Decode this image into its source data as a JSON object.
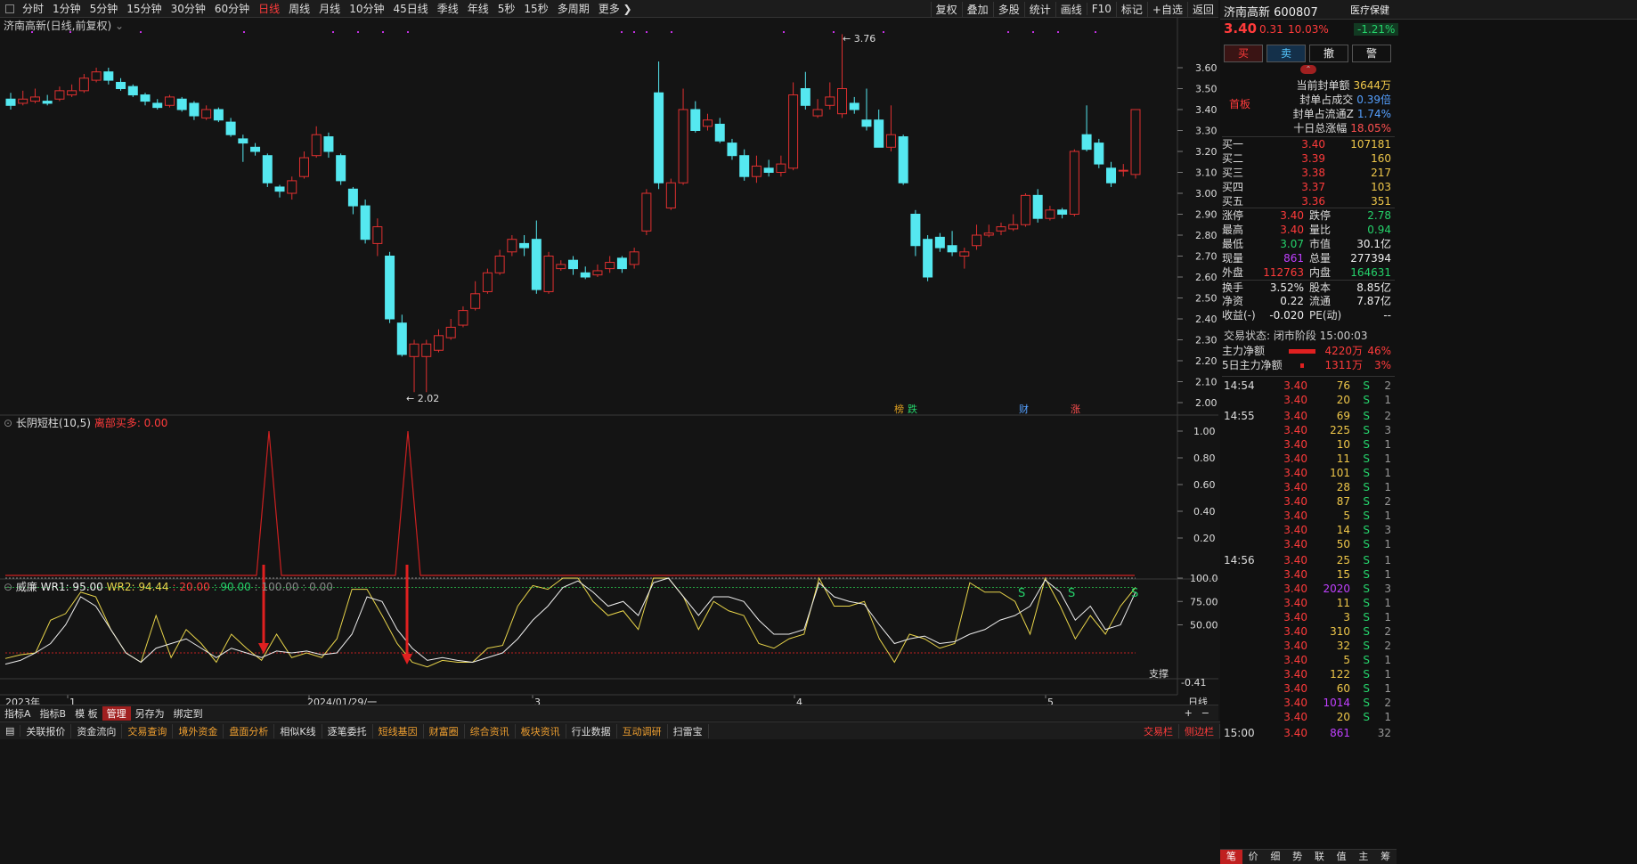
{
  "toolbar": {
    "left": [
      "分时",
      "1分钟",
      "5分钟",
      "15分钟",
      "30分钟",
      "60分钟",
      "日线",
      "周线",
      "月线",
      "10分钟",
      "45日线",
      "季线",
      "年线",
      "5秒",
      "15秒",
      "多周期",
      "更多 ❯"
    ],
    "active": "日线",
    "right": [
      "复权",
      "叠加",
      "多股",
      "统计",
      "画线",
      "F10",
      "标记",
      "+自选",
      "返回"
    ]
  },
  "chart_title": "济南高新(日线,前复权)",
  "price_axis": [
    "3.60",
    "3.50",
    "3.40",
    "3.30",
    "3.20",
    "3.10",
    "3.00",
    "2.90",
    "2.80",
    "2.70",
    "2.60",
    "2.50",
    "2.40",
    "2.30",
    "2.20",
    "2.10",
    "2.00"
  ],
  "high_marker": "3.76",
  "low_marker": "2.02",
  "event_tags": [
    "榜",
    "跌",
    "财",
    "涨"
  ],
  "ind1": {
    "title": "长阴短柱(10,5)",
    "sub": "离部买多: 0.00",
    "axis": [
      "1.00",
      "0.80",
      "0.60",
      "0.40",
      "0.20"
    ]
  },
  "ind2": {
    "name": "威廉",
    "wr1": "WR1: 95.00",
    "wr2": "WR2: 94.44",
    "lv1": ": 20.00",
    "lv2": ": 90.00",
    "lv3": ": 100.00 : 0.00",
    "axis": [
      "100.0",
      "75.00",
      "50.00"
    ],
    "bottom": "-0.41",
    "support": "支撑",
    "s_label": "S"
  },
  "date_axis": {
    "start": "2023年",
    "marks": [
      "1",
      "2024/01/29/一",
      "3",
      "4",
      "5"
    ],
    "period": "日线"
  },
  "tabs": [
    "指标A",
    "指标B",
    "模 板",
    "管理",
    "另存为",
    "绑定到"
  ],
  "tabs_right": [
    "+",
    "−"
  ],
  "footer": [
    "关联报价",
    "资金流向",
    "交易查询",
    "境外资金",
    "盘面分析",
    "相似K线",
    "逐笔委托",
    "短线基因",
    "财富圈",
    "综合资讯",
    "板块资讯",
    "行业数据",
    "互动调研",
    "扫雷宝"
  ],
  "footer_hl": [
    "交易查询",
    "境外资金",
    "盘面分析",
    "短线基因",
    "财富圈",
    "综合资讯",
    "板块资讯",
    "互动调研"
  ],
  "footer_right": [
    "交易栏",
    "侧边栏"
  ],
  "quote": {
    "name": "济南高新",
    "code": "600807",
    "sector": "医疗保健",
    "sector_chg": "-1.21%",
    "price": "3.40",
    "change": "0.31",
    "pct": "10.03%",
    "buy": "买",
    "sell": "卖",
    "cancel": "撤",
    "alert": "警",
    "limit_tag": "首板",
    "seal": [
      [
        "当前封单额",
        "3644万"
      ],
      [
        "封单占成交",
        "0.39倍"
      ],
      [
        "封单占流通Z",
        "1.74%"
      ],
      [
        "十日总涨幅",
        "18.05%"
      ]
    ],
    "bids": [
      [
        "买一",
        "3.40",
        "107181"
      ],
      [
        "买二",
        "3.39",
        "160"
      ],
      [
        "买三",
        "3.38",
        "217"
      ],
      [
        "买四",
        "3.37",
        "103"
      ],
      [
        "买五",
        "3.36",
        "351"
      ]
    ],
    "stats": [
      [
        "涨停",
        "3.40",
        "跌停",
        "2.78"
      ],
      [
        "最高",
        "3.40",
        "量比",
        "0.94"
      ],
      [
        "最低",
        "3.07",
        "市值",
        "30.1亿"
      ],
      [
        "现量",
        "861",
        "总量",
        "277394"
      ],
      [
        "外盘",
        "112763",
        "内盘",
        "164631"
      ],
      [
        "换手",
        "3.52%",
        "股本",
        "8.85亿"
      ],
      [
        "净资",
        "0.22",
        "流通",
        "7.87亿"
      ],
      [
        "收益(-)",
        "-0.020",
        "PE(动)",
        "--"
      ]
    ],
    "status": "交易状态: 闭市阶段 15:00:03",
    "flow": [
      [
        "主力净额",
        "4220万",
        "46%"
      ],
      [
        "5日主力净额",
        "1311万",
        "3%"
      ]
    ],
    "ticks": [
      [
        "14:54",
        "3.40",
        "76",
        "S",
        "2"
      ],
      [
        "",
        "3.40",
        "20",
        "S",
        "1"
      ],
      [
        "14:55",
        "3.40",
        "69",
        "S",
        "2"
      ],
      [
        "",
        "3.40",
        "225",
        "S",
        "3"
      ],
      [
        "",
        "3.40",
        "10",
        "S",
        "1"
      ],
      [
        "",
        "3.40",
        "11",
        "S",
        "1"
      ],
      [
        "",
        "3.40",
        "101",
        "S",
        "1"
      ],
      [
        "",
        "3.40",
        "28",
        "S",
        "1"
      ],
      [
        "",
        "3.40",
        "87",
        "S",
        "2"
      ],
      [
        "",
        "3.40",
        "5",
        "S",
        "1"
      ],
      [
        "",
        "3.40",
        "14",
        "S",
        "3"
      ],
      [
        "",
        "3.40",
        "50",
        "S",
        "1"
      ],
      [
        "14:56",
        "3.40",
        "25",
        "S",
        "1"
      ],
      [
        "",
        "3.40",
        "15",
        "S",
        "1"
      ],
      [
        "",
        "3.40",
        "2020",
        "S",
        "3"
      ],
      [
        "",
        "3.40",
        "11",
        "S",
        "1"
      ],
      [
        "",
        "3.40",
        "3",
        "S",
        "1"
      ],
      [
        "",
        "3.40",
        "310",
        "S",
        "2"
      ],
      [
        "",
        "3.40",
        "32",
        "S",
        "2"
      ],
      [
        "",
        "3.40",
        "5",
        "S",
        "1"
      ],
      [
        "",
        "3.40",
        "122",
        "S",
        "1"
      ],
      [
        "",
        "3.40",
        "60",
        "S",
        "1"
      ],
      [
        "",
        "3.40",
        "1014",
        "S",
        "2"
      ],
      [
        "",
        "3.40",
        "20",
        "S",
        "1"
      ],
      [
        "15:00",
        "3.40",
        "861",
        "",
        "32"
      ]
    ],
    "tabs": [
      "笔",
      "价",
      "细",
      "势",
      "联",
      "值",
      "主",
      "筹"
    ]
  }
}
